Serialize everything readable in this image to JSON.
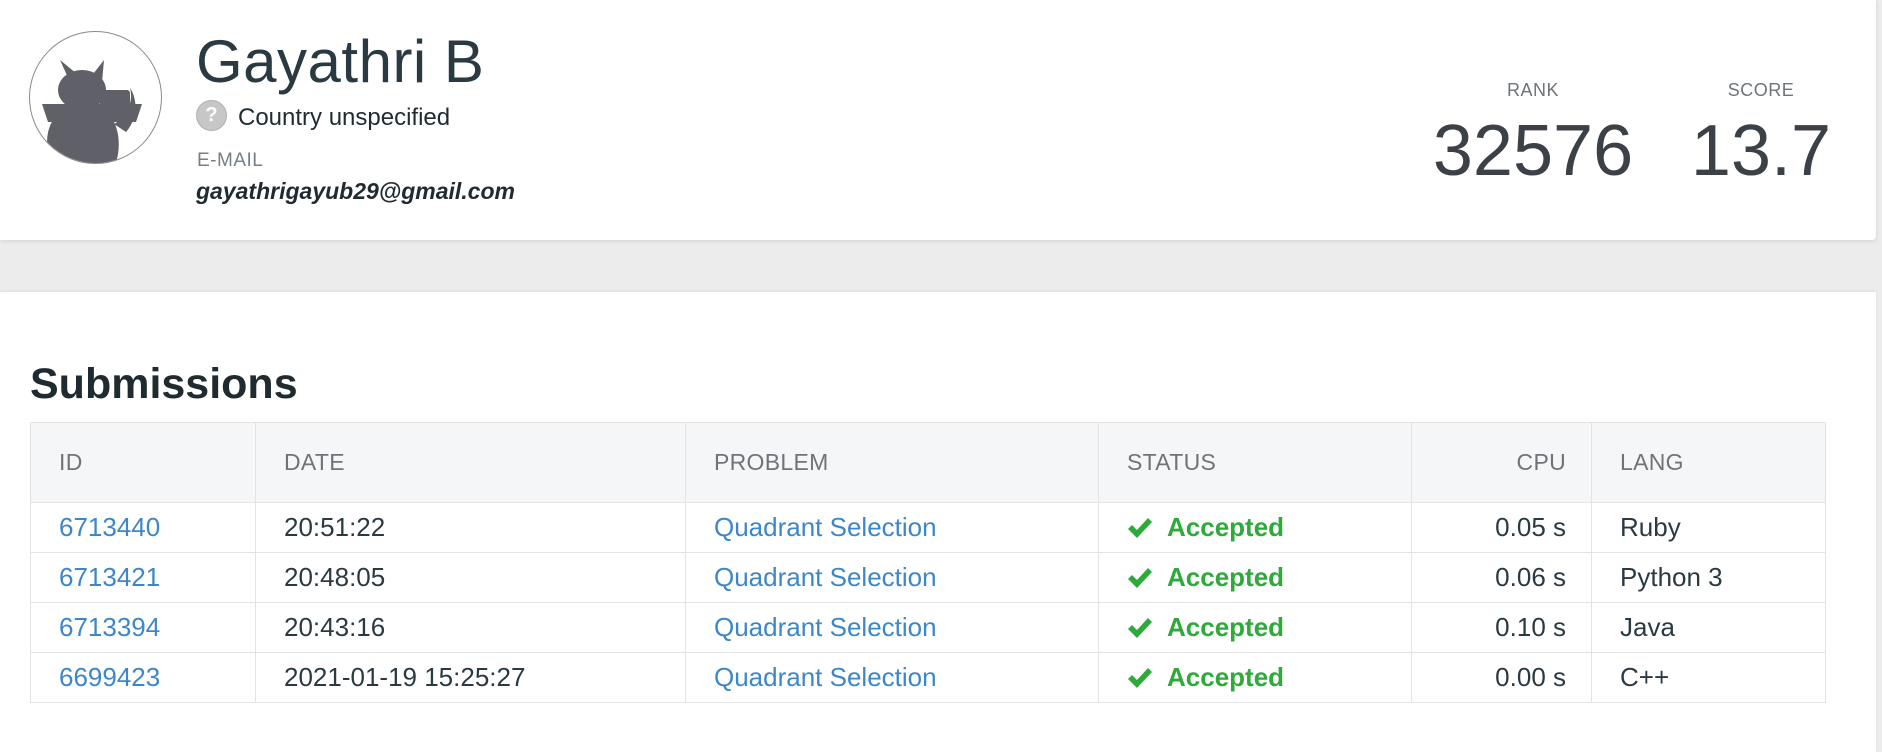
{
  "profile": {
    "name": "Gayathri B",
    "country_icon": "question-mark-icon",
    "country": "Country unspecified",
    "email_label": "E-MAIL",
    "email": "gayathrigayub29@gmail.com",
    "avatar_icon": "cat-silhouette-avatar",
    "rank_label": "RANK",
    "rank": "32576",
    "score_label": "SCORE",
    "score": "13.7"
  },
  "submissions": {
    "title": "Submissions",
    "columns": {
      "id": "ID",
      "date": "DATE",
      "problem": "PROBLEM",
      "status": "STATUS",
      "cpu": "CPU",
      "lang": "LANG"
    },
    "rows": [
      {
        "id": "6713440",
        "date": "20:51:22",
        "problem": "Quadrant Selection",
        "status": "Accepted",
        "cpu": "0.05 s",
        "lang": "Ruby"
      },
      {
        "id": "6713421",
        "date": "20:48:05",
        "problem": "Quadrant Selection",
        "status": "Accepted",
        "cpu": "0.06 s",
        "lang": "Python 3"
      },
      {
        "id": "6713394",
        "date": "20:43:16",
        "problem": "Quadrant Selection",
        "status": "Accepted",
        "cpu": "0.10 s",
        "lang": "Java"
      },
      {
        "id": "6699423",
        "date": "2021-01-19 15:25:27",
        "problem": "Quadrant Selection",
        "status": "Accepted",
        "cpu": "0.00 s",
        "lang": "C++"
      }
    ]
  },
  "colors": {
    "link": "#3d87c9",
    "accepted": "#2eaa3a",
    "background": "#ececec"
  }
}
